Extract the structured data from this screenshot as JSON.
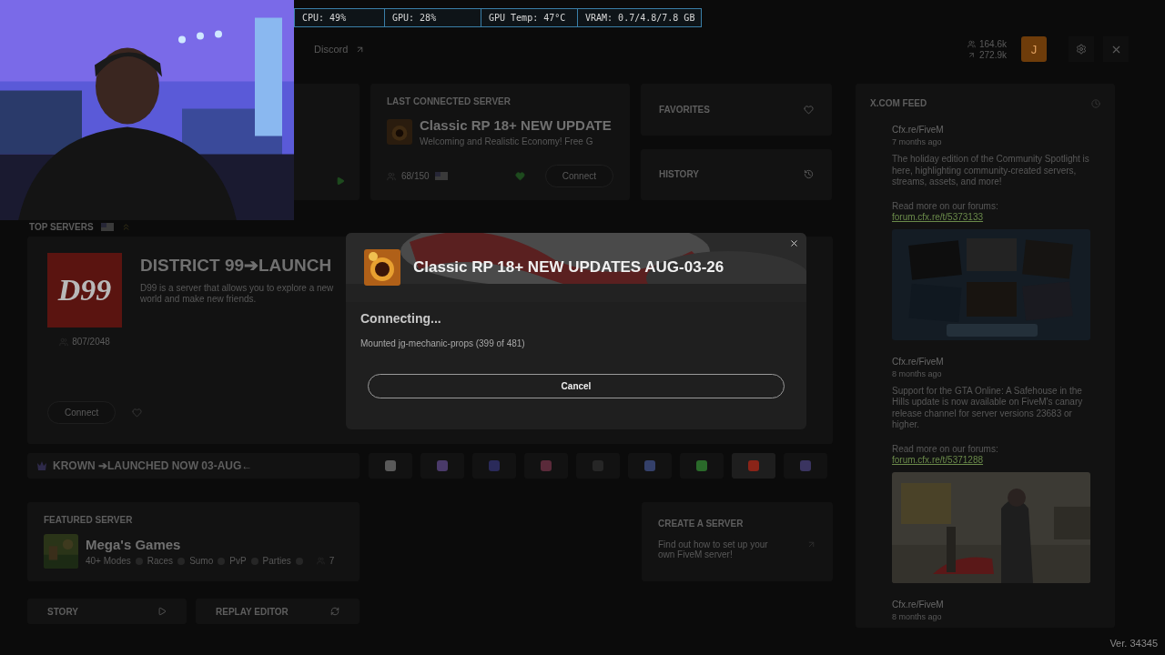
{
  "webcam": {
    "kind": "picture"
  },
  "stats_overlay": [
    "CPU: 49%",
    "GPU: 28%",
    "GPU Temp: 47°C",
    "VRAM: 0.7/4.8/7.8 GB"
  ],
  "top_bar": {
    "link": "Discord",
    "players": "164.6k",
    "servers": "272.9k",
    "avatar": "J"
  },
  "last_connected": {
    "heading": "LAST CONNECTED SERVER",
    "name": "Classic RP 18+ NEW UPDATE",
    "description": "Welcoming and Realistic Economy! Free G",
    "players": "68/150",
    "favorite": true,
    "button": "Connect"
  },
  "side_panels": [
    {
      "kind": "favorites",
      "label": "FAVORITES"
    },
    {
      "kind": "history",
      "label": "HISTORY"
    }
  ],
  "top_servers": {
    "heading": "TOP SERVERS",
    "logo": "D99",
    "name": "DISTRICT 99➔LAUNCH",
    "description": "D99 is a server that allows you to explore a new world and make new friends.",
    "players": "807/2048",
    "button": "Connect",
    "favorite": false
  },
  "banner": {
    "name": "KROWN ➔LAUNCHED NOW 03-AUG←"
  },
  "server_tiles": [
    {
      "color": "#5a5a5a",
      "selected": false
    },
    {
      "color": "#4a3a6a",
      "selected": false
    },
    {
      "color": "#2a2a5a",
      "selected": false
    },
    {
      "color": "#5a2a3a",
      "selected": false
    },
    {
      "color": "#262626",
      "selected": false
    },
    {
      "color": "#34406a",
      "selected": false
    },
    {
      "color": "#2a6a2a",
      "selected": false
    },
    {
      "color": "#8a2418",
      "selected": true
    },
    {
      "color": "#3a3460",
      "selected": false
    }
  ],
  "featured": {
    "heading": "FEATURED SERVER",
    "name": "Mega's Games",
    "tags": [
      "40+ Modes",
      "Races",
      "Sumo",
      "PvP",
      "Parties"
    ],
    "players": "7"
  },
  "create_server": {
    "heading": "CREATE A SERVER",
    "description": "Find out how to set up your own FiveM server!"
  },
  "bottom_buttons": [
    {
      "kind": "story",
      "label": "STORY"
    },
    {
      "kind": "replay",
      "label": "REPLAY EDITOR"
    }
  ],
  "feed": {
    "heading": "X.COM FEED",
    "posts": [
      {
        "author": "Cfx.re/FiveM",
        "time": "7 months ago",
        "text": "The holiday edition of the Community Spotlight is here, highlighting community-created servers, streams, assets, and more!",
        "more": "Read more on our forums:",
        "link": "forum.cfx.re/t/5373133",
        "image": {
          "kind": "picture"
        }
      },
      {
        "author": "Cfx.re/FiveM",
        "time": "8 months ago",
        "text": "Support for the GTA Online: A Safehouse in the Hills update is now available on FiveM's canary release channel for server versions 23683 or higher.",
        "more": "Read more on our forums:",
        "link": "forum.cfx.re/t/5371288",
        "image": {
          "kind": "picture"
        }
      },
      {
        "author": "Cfx.re/FiveM",
        "time": "8 months ago"
      }
    ]
  },
  "modal": {
    "server_name": "Classic RP 18+ NEW UPDATES AUG-03-26",
    "status": "Connecting...",
    "detail": "Mounted jg-mechanic-props (399 of 481)",
    "button": "Cancel"
  },
  "version": "Ver. 34345"
}
